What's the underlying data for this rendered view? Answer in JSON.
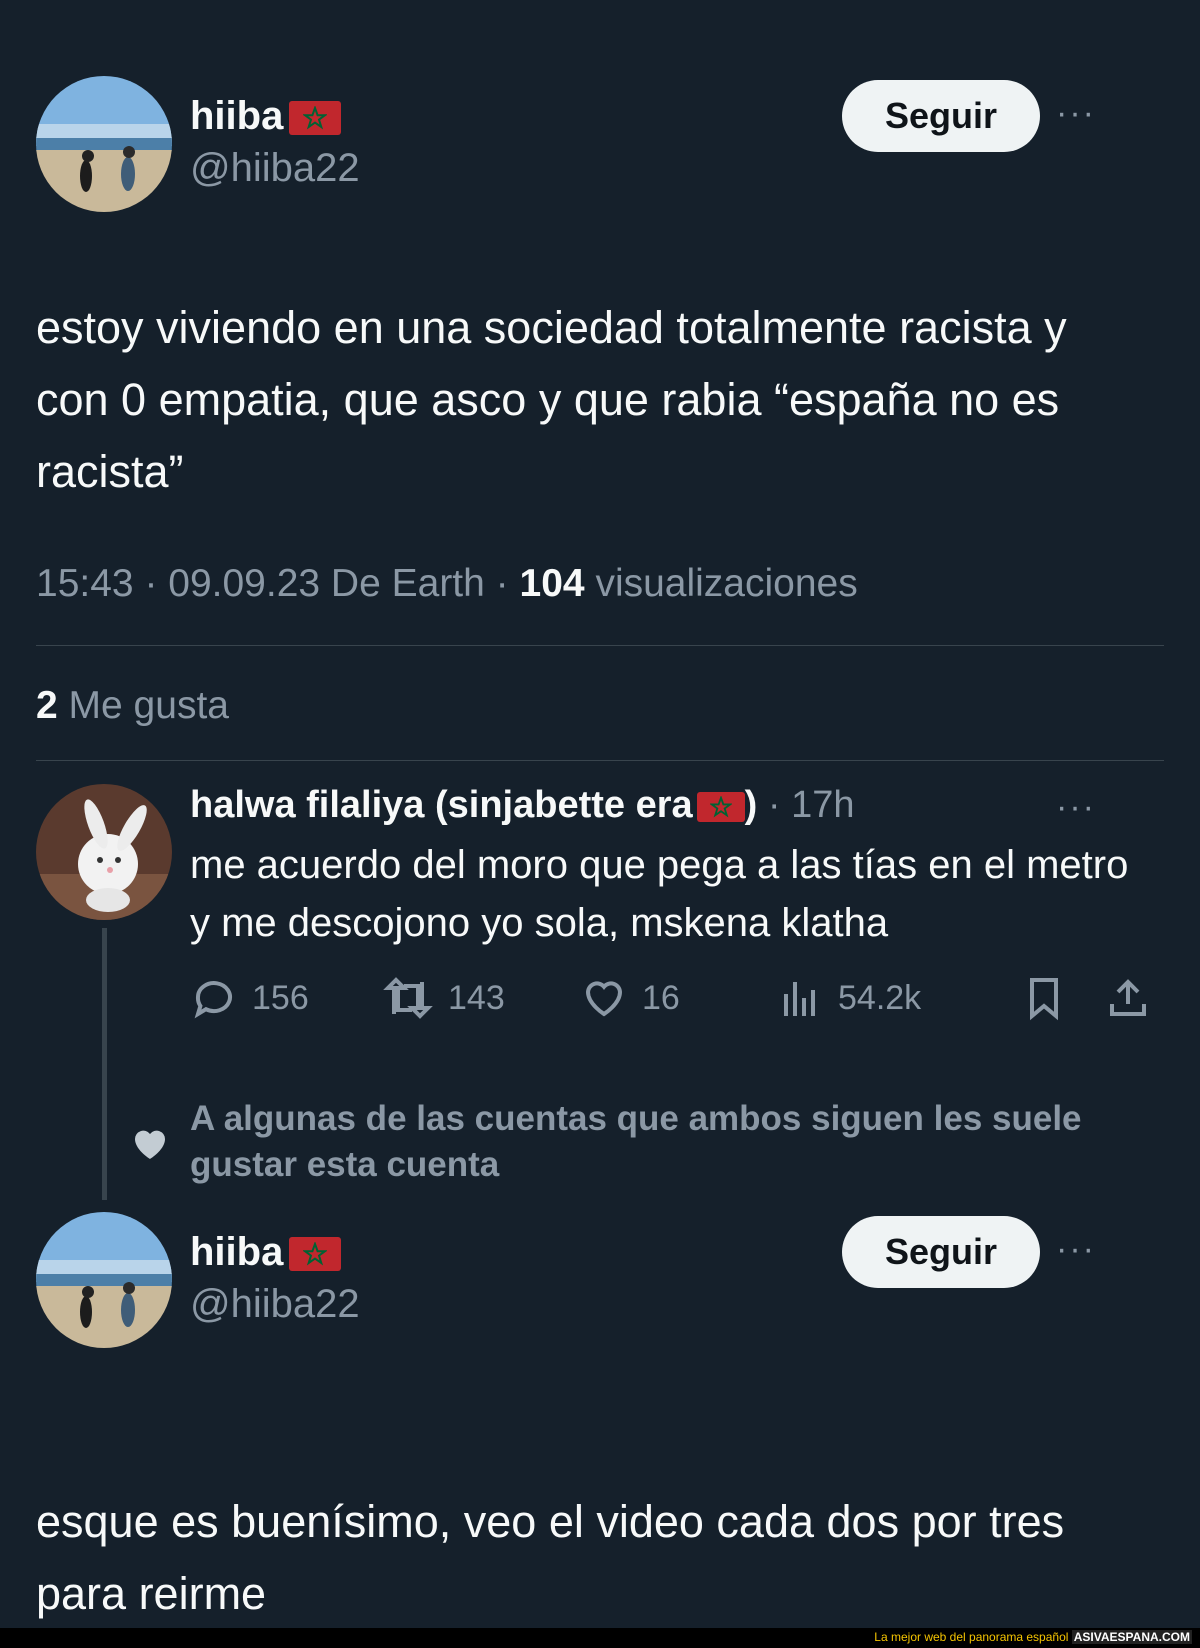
{
  "tweet": {
    "user_name": "hiiba",
    "flag_icon": "morocco-flag",
    "handle": "@hiiba22",
    "follow_label": "Seguir",
    "more_icon": "···",
    "text": "estoy viviendo en una sociedad totalmente racista y con 0 empatia, que asco y que rabia “españa no es racista”",
    "time": "15:43",
    "date_source": "09.09.23 De Earth",
    "views_count": "104",
    "views_label": "visualizaciones",
    "likes_count": "2",
    "likes_label": "Me gusta"
  },
  "reply": {
    "user_name": "halwa filaliya (sinjabette era",
    "name_close": ")",
    "age": "· 17h",
    "more_icon": "···",
    "text": "me acuerdo del moro que pega a las tías en el metro y me descojono yo sola, mskena klatha",
    "comments": "156",
    "retweets": "143",
    "likes": "16",
    "views": "54.2k"
  },
  "social_context": {
    "text": "A algunas de las cuentas que ambos siguen les suele gustar esta cuenta",
    "icon": "heart-icon"
  },
  "reply2": {
    "user_name": "hiiba",
    "handle": "@hiiba22",
    "follow_label": "Seguir",
    "more_icon": "···",
    "text": "esque es buenísimo, veo el video cada dos por tres para reirme"
  },
  "footer": {
    "tagline": "La mejor web del panorama español",
    "site": "ASIVAESPANA.COM"
  },
  "colors": {
    "background": "#15202b",
    "text": "#f7f9f9",
    "secondary": "#8b98a5",
    "divider": "#38444d",
    "flag_red": "#c1272d",
    "flag_green": "#006233"
  }
}
